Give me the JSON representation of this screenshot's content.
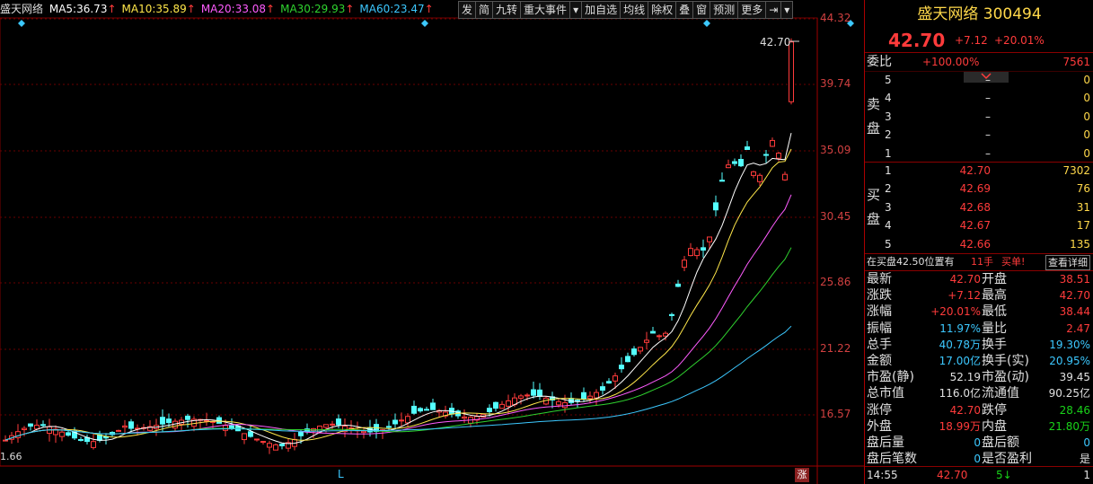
{
  "header": {
    "stock_name": "盛天网络",
    "ma_items": [
      {
        "label": "MA5:",
        "value": "36.73",
        "arrow": "↑",
        "color": "#ffffff"
      },
      {
        "label": "MA10:",
        "value": "35.89",
        "arrow": "↑",
        "color": "#ffe74a"
      },
      {
        "label": "MA20:",
        "value": "33.08",
        "arrow": "↑",
        "color": "#ff5cff"
      },
      {
        "label": "MA30:",
        "value": "29.93",
        "arrow": "↑",
        "color": "#2fd32f"
      },
      {
        "label": "MA60:",
        "value": "23.47",
        "arrow": "↑",
        "color": "#3cc8ff"
      }
    ]
  },
  "toolbar": {
    "buttons": [
      "发",
      "简",
      "九转",
      "重大事件",
      "▾",
      "加自选",
      "均线",
      "除权",
      "叠",
      "窗",
      "预测",
      "更多",
      "⇥",
      "▾"
    ]
  },
  "chart": {
    "price_ticks": [
      "44.32",
      "39.74",
      "35.09",
      "30.45",
      "25.86",
      "21.22",
      "16.57"
    ],
    "last_label": "42.70",
    "low_label": "1.66",
    "marker_L": "L",
    "zhang_badge": "涨"
  },
  "quote": {
    "title": "盛天网络",
    "code": "300494",
    "price": "42.70",
    "change": "+7.12",
    "pct": "+20.01%"
  },
  "weibi": {
    "label": "委比",
    "value": "+100.00%",
    "diff": "7561"
  },
  "sell": {
    "side_label": [
      "卖",
      "盘"
    ],
    "rows": [
      {
        "lvl": "5",
        "price": "–",
        "vol": "0"
      },
      {
        "lvl": "4",
        "price": "–",
        "vol": "0"
      },
      {
        "lvl": "3",
        "price": "–",
        "vol": "0"
      },
      {
        "lvl": "2",
        "price": "–",
        "vol": "0"
      },
      {
        "lvl": "1",
        "price": "–",
        "vol": "0"
      }
    ]
  },
  "buy": {
    "side_label": [
      "买",
      "盘"
    ],
    "rows": [
      {
        "lvl": "1",
        "price": "42.70",
        "vol": "7302"
      },
      {
        "lvl": "2",
        "price": "42.69",
        "vol": "76"
      },
      {
        "lvl": "3",
        "price": "42.68",
        "vol": "31"
      },
      {
        "lvl": "4",
        "price": "42.67",
        "vol": "17"
      },
      {
        "lvl": "5",
        "price": "42.66",
        "vol": "135"
      }
    ]
  },
  "notice": {
    "text": "在买盘42.50位置有",
    "lots": "11手",
    "action": "买单!",
    "detail": "查看详细"
  },
  "stats": [
    {
      "l1": "最新",
      "v1": "42.70",
      "c1": "red",
      "l2": "开盘",
      "v2": "38.51",
      "c2": "red"
    },
    {
      "l1": "涨跌",
      "v1": "+7.12",
      "c1": "red",
      "l2": "最高",
      "v2": "42.70",
      "c2": "red"
    },
    {
      "l1": "涨幅",
      "v1": "+20.01%",
      "c1": "red",
      "l2": "最低",
      "v2": "38.44",
      "c2": "red"
    },
    {
      "l1": "振幅",
      "v1": "11.97%",
      "c1": "cyan",
      "l2": "量比",
      "v2": "2.47",
      "c2": "red"
    },
    {
      "l1": "总手",
      "v1": "40.78万",
      "c1": "cyan",
      "l2": "换手",
      "v2": "19.30%",
      "c2": "cyan"
    },
    {
      "l1": "金额",
      "v1": "17.00亿",
      "c1": "cyan",
      "l2": "换手(实)",
      "v2": "20.95%",
      "c2": "cyan"
    },
    {
      "l1": "市盈(静)",
      "v1": "52.19",
      "c1": "white",
      "l2": "市盈(动)",
      "v2": "39.45",
      "c2": "white"
    },
    {
      "l1": "总市值",
      "v1": "116.0亿",
      "c1": "white",
      "l2": "流通值",
      "v2": "90.25亿",
      "c2": "white"
    },
    {
      "l1": "涨停",
      "v1": "42.70",
      "c1": "red",
      "l2": "跌停",
      "v2": "28.46",
      "c2": "green"
    },
    {
      "l1": "外盘",
      "v1": "18.99万",
      "c1": "red",
      "l2": "内盘",
      "v2": "21.80万",
      "c2": "green"
    },
    {
      "l1": "盘后量",
      "v1": "0",
      "c1": "cyan",
      "l2": "盘后额",
      "v2": "0",
      "c2": "cyan"
    },
    {
      "l1": "盘后笔数",
      "v1": "0",
      "c1": "cyan",
      "l2": "是否盈利",
      "v2": "是",
      "c2": "white"
    }
  ],
  "tick": {
    "time": "14:55",
    "price": "42.70",
    "vol": "5",
    "arrow": "↓",
    "count": "1"
  }
}
